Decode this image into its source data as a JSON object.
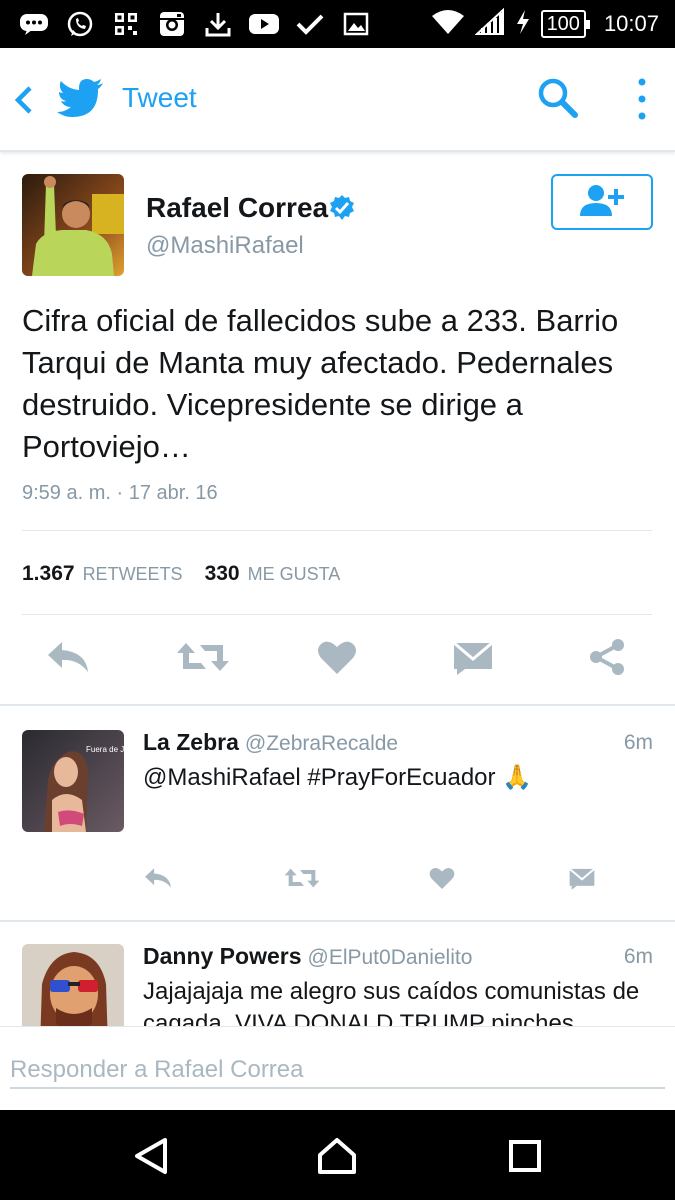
{
  "status_bar": {
    "battery": "100",
    "time": "10:07",
    "icons": [
      "chat-icon",
      "whatsapp-icon",
      "qr-icon",
      "instagram-icon",
      "download-icon",
      "youtube-icon",
      "check-icon",
      "image-icon"
    ]
  },
  "app_bar": {
    "title": "Tweet"
  },
  "tweet": {
    "author_name": "Rafael Correa",
    "author_handle": "@MashiRafael",
    "text": "Cifra oficial de fallecidos sube a 233. Barrio Tarqui de Manta muy afectado. Pedernales destruido. Vicepresidente se dirige a Portoviejo…",
    "timestamp": "9:59 a. m. · 17 abr. 16",
    "retweets_count": "1.367",
    "retweets_label": "RETWEETS",
    "likes_count": "330",
    "likes_label": "ME GUSTA"
  },
  "replies": [
    {
      "name": "La Zebra",
      "handle": "@ZebraRecalde",
      "time": "6m",
      "text": "@MashiRafael #PrayForEcuador 🙏",
      "avatar_text": "Fuera de Juego"
    },
    {
      "name": "Danny Powers",
      "handle": "@ElPut0Danielito",
      "time": "6m",
      "text": "Jajajajaja me alegro sus caídos comunistas de cagada. VIVA DONALD TRUMP pinches"
    }
  ],
  "compose": {
    "placeholder": "Responder a Rafael Correa"
  },
  "colors": {
    "brand": "#1da1f2",
    "muted": "#8899a6",
    "icon": "#aab8c2",
    "divider": "#e1e8ed"
  }
}
